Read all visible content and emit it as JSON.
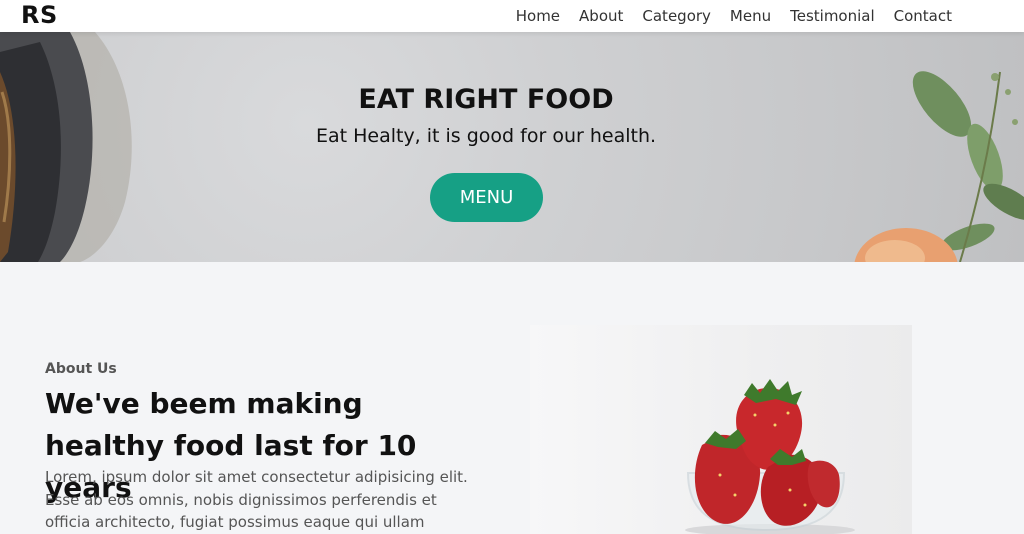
{
  "brand": {
    "logo": "RS"
  },
  "nav": {
    "items": [
      {
        "label": "Home"
      },
      {
        "label": "About"
      },
      {
        "label": "Category"
      },
      {
        "label": "Menu"
      },
      {
        "label": "Testimonial"
      },
      {
        "label": "Contact"
      }
    ]
  },
  "hero": {
    "title": "EAT RIGHT FOOD",
    "subtitle": "Eat Healty, it is good for our health.",
    "button_label": "MENU",
    "button_color": "#16a085"
  },
  "about": {
    "label": "About Us",
    "heading": "We've beem making healthy food last for 10 years",
    "text": "Lorem, ipsum dolor sit amet consectetur adipisicing elit. Esse ab eos omnis, nobis dignissimos perferendis et officia architecto, fugiat possimus eaque qui ullam"
  },
  "icons": {
    "hero_left": "dish-image",
    "hero_right": "leaves-and-apple-image",
    "about_image": "strawberries-in-glass-bowl-image"
  }
}
